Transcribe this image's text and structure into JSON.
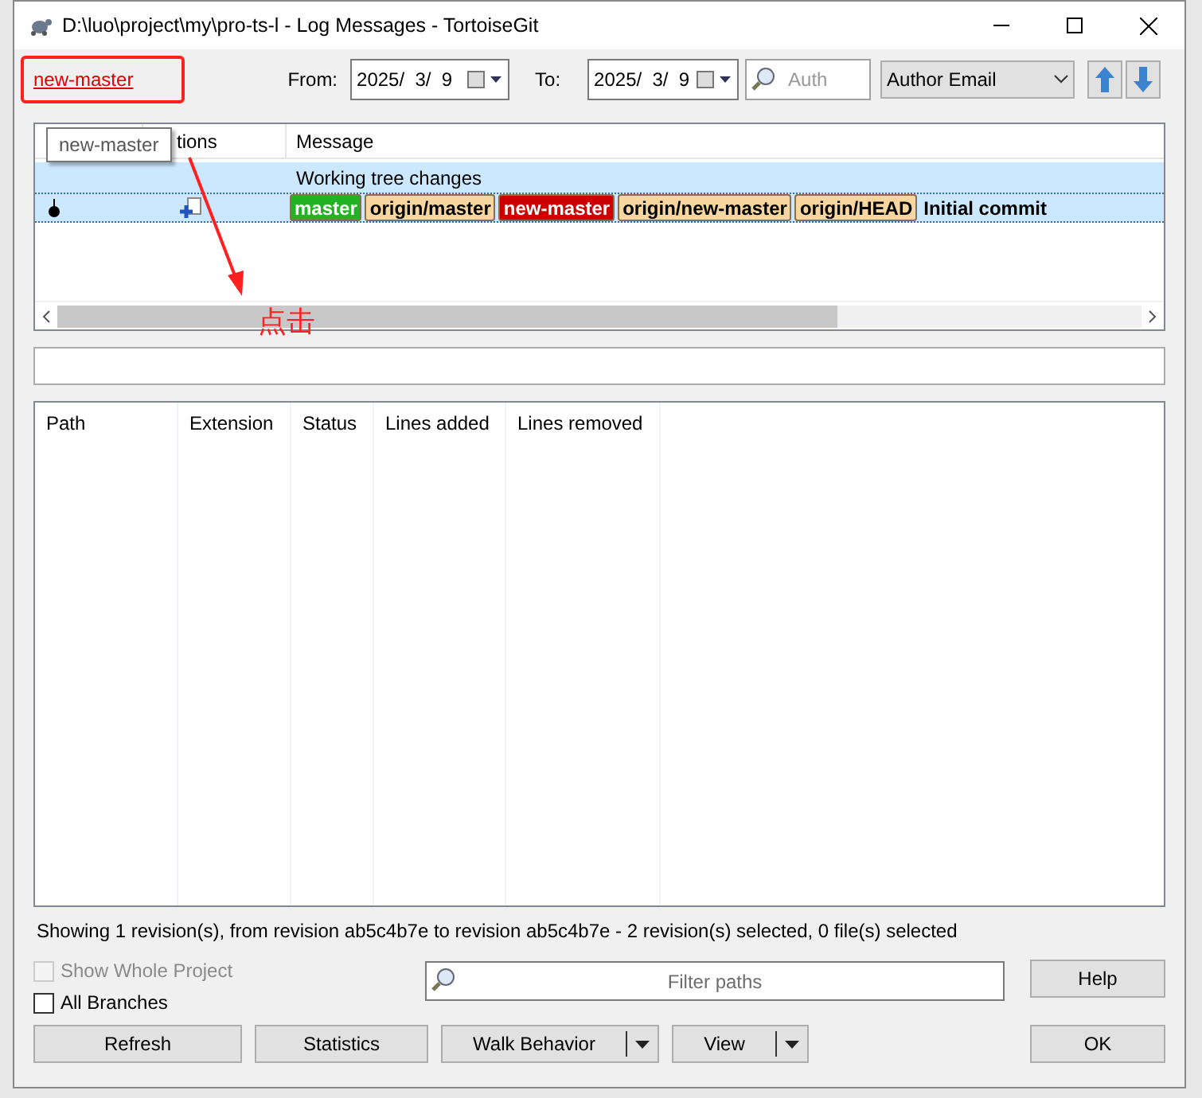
{
  "window": {
    "title": "D:\\luo\\project\\my\\pro-ts-l - Log Messages - TortoiseGit"
  },
  "toolbar": {
    "branch_link": "new-master",
    "from_label": "From:",
    "from_date": "2025/  3/  9",
    "to_label": "To:",
    "to_date": "2025/  3/  9",
    "search": {
      "placeholder": "Auth"
    },
    "filter_by": "Author Email"
  },
  "log_list": {
    "columns": [
      "tions",
      "Message"
    ],
    "tooltip": "new-master",
    "rows": [
      {
        "kind": "working",
        "message": "Working tree changes",
        "selected": true
      },
      {
        "kind": "commit",
        "message": "Initial commit",
        "selected": true,
        "refs": [
          {
            "label": "master",
            "color": "#22b322"
          },
          {
            "label": "origin/master",
            "color": "#f8d6a0"
          },
          {
            "label": "new-master",
            "color": "#cc0000"
          },
          {
            "label": "origin/new-master",
            "color": "#f8d6a0"
          },
          {
            "label": "origin/HEAD",
            "color": "#f8d6a0"
          }
        ]
      }
    ]
  },
  "file_list": {
    "columns": [
      "Path",
      "Extension",
      "Status",
      "Lines added",
      "Lines removed"
    ]
  },
  "status_bar": "Showing 1 revision(s), from revision ab5c4b7e to revision ab5c4b7e - 2 revision(s) selected, 0 file(s) selected",
  "options": [
    {
      "label": "Show Whole Project",
      "checked": false,
      "disabled": true
    },
    {
      "label": "All Branches",
      "checked": false,
      "disabled": false
    }
  ],
  "filter": {
    "placeholder": "Filter paths"
  },
  "buttons": [
    {
      "label": "Refresh",
      "kind": "plain"
    },
    {
      "label": "Statistics",
      "kind": "plain"
    },
    {
      "label": "Walk Behavior",
      "kind": "split"
    },
    {
      "label": "View",
      "kind": "split"
    }
  ],
  "help_button": "Help",
  "ok_button": "OK",
  "annotation": {
    "text": "点击"
  }
}
